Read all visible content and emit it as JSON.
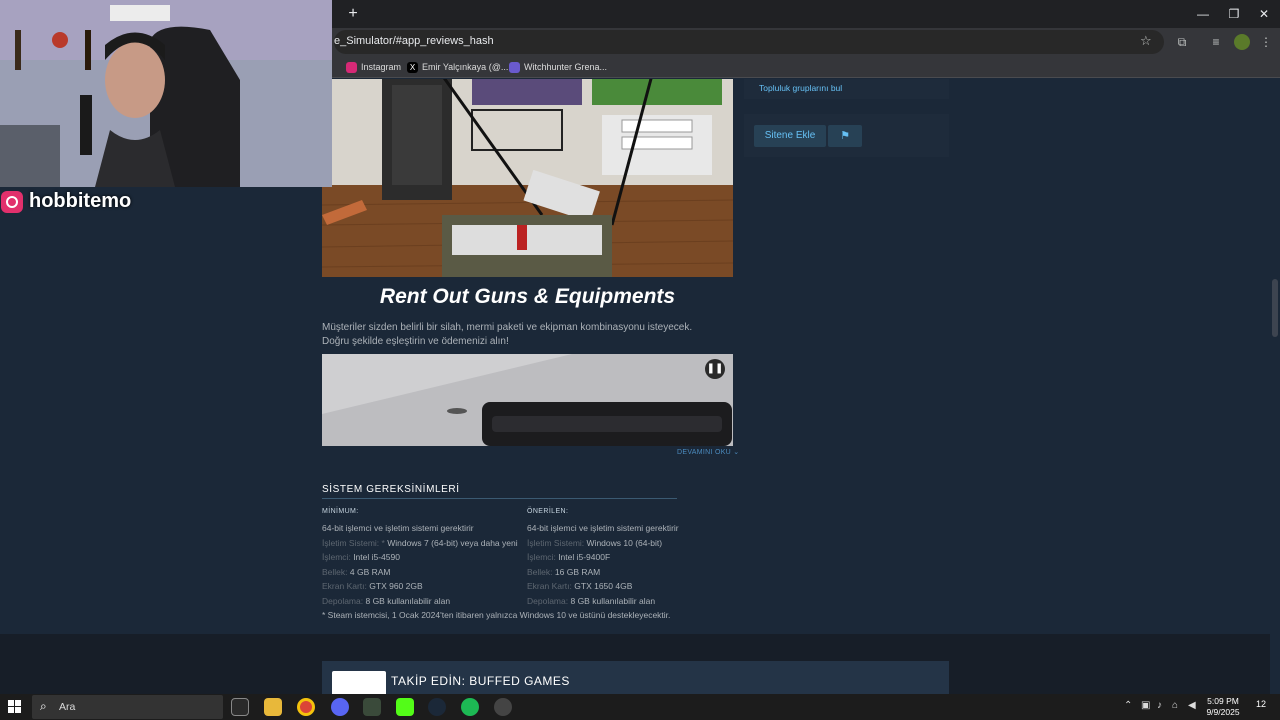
{
  "browser": {
    "url": "e_Simulator/#app_reviews_hash",
    "bookmarks": [
      {
        "label": "Instagram"
      },
      {
        "label": "Emir Yalçınkaya (@..."
      },
      {
        "label": "Witchhunter Grena..."
      }
    ]
  },
  "stream": {
    "instagram_handle": "hobbitemo"
  },
  "sidebar": {
    "community_link": "Topluluk gruplarını bul",
    "add_to_site": "Sitene Ekle"
  },
  "feature": {
    "title": "Rent Out Guns & Equipments",
    "description": "Müşteriler sizden belirli bir silah, mermi paketi ve ekipman kombinasyonu isteyecek. Doğru şekilde eşleştirin ve ödemenizi alın!",
    "read_more": "DEVAMINI OKU ⌄"
  },
  "sysreq": {
    "heading": "SİSTEM GEREKSİNİMLERİ",
    "minimum": {
      "label": "MİNİMUM:",
      "requires": "64-bit işlemci ve işletim sistemi gerektirir",
      "os_key": "İşletim Sistemi: *",
      "os": "Windows 7 (64-bit) veya daha yeni",
      "cpu_key": "İşlemci:",
      "cpu": "Intel i5-4590",
      "ram_key": "Bellek:",
      "ram": "4 GB RAM",
      "gpu_key": "Ekran Kartı:",
      "gpu": "GTX 960 2GB",
      "storage_key": "Depolama:",
      "storage": "8 GB kullanılabilir alan"
    },
    "recommended": {
      "label": "ÖNERİLEN:",
      "requires": "64-bit işlemci ve işletim sistemi gerektirir",
      "os_key": "İşletim Sistemi:",
      "os": "Windows 10 (64-bit)",
      "cpu_key": "İşlemci:",
      "cpu": "Intel i5-9400F",
      "ram_key": "Bellek:",
      "ram": "16 GB RAM",
      "gpu_key": "Ekran Kartı:",
      "gpu": "GTX 1650 4GB",
      "storage_key": "Depolama:",
      "storage": "8 GB kullanılabilir alan"
    },
    "note": "* Steam istemcisi, 1 Ocak 2024'ten itibaren yalnızca Windows 10 ve üstünü destekleyecektir."
  },
  "follow": {
    "title": "TAKİP EDİN: BUFFED GAMES"
  },
  "taskbar": {
    "search_label": "Ara",
    "time": "5:09 PM",
    "date": "9/9/2025",
    "notifications": "12"
  },
  "colors": {
    "steam_bg": "#1b2838",
    "steam_link": "#66c0f4",
    "chrome_dark": "#202124"
  }
}
